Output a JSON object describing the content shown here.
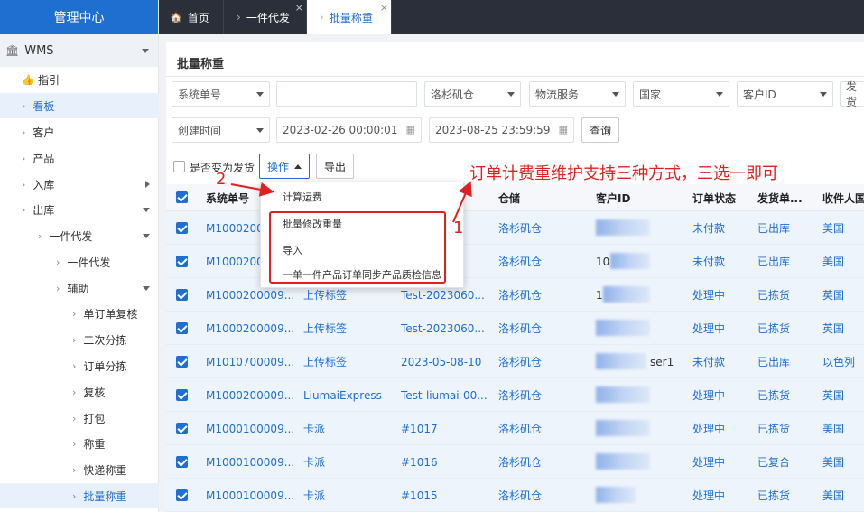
{
  "sidebar": {
    "header": "管理中心",
    "section": "WMS",
    "items": {
      "guide": "指引",
      "board": "看板",
      "customer": "客户",
      "product": "产品",
      "inbound": "入库",
      "outbound": "出库",
      "dropship_group": "一件代发",
      "dropship": "一件代发",
      "aux": "辅助",
      "single_review": "单订单复核",
      "second_sort": "二次分拣",
      "order_sort": "订单分拣",
      "review": "复核",
      "pack": "打包",
      "weigh": "称重",
      "express_weigh": "快递称重",
      "batch_weigh": "批量称重"
    }
  },
  "tabs": {
    "home": "首页",
    "dropship": "一件代发",
    "batch_weigh": "批量称重",
    "close": "×"
  },
  "panel": {
    "title": "批量称重",
    "filters": {
      "field_select": "系统单号",
      "field_input": "",
      "warehouse": "洛杉矶仓",
      "logistics": "物流服务",
      "country": "国家",
      "customer_id": "客户ID",
      "shipping_cut": "发货",
      "time_select": "创建时间",
      "start_time": "2023-02-26 00:00:01",
      "end_time": "2023-08-25 23:59:59",
      "query": "查询"
    },
    "toolbar": {
      "ship_toggle": "是否变为发货",
      "operate": "操作",
      "export": "导出"
    },
    "dropdown": {
      "calc_fee": "计算运费",
      "batch_edit_weight": "批量修改重量",
      "import": "导入",
      "sync_qc": "一单一件产品订单同步产品质检信息"
    },
    "annotation": {
      "text": "订单计费重维护支持三种方式，三选一即可",
      "num1": "1",
      "num2": "2"
    },
    "table": {
      "headers": {
        "sysno": "系统单号",
        "warehouse": "仓储",
        "customer_id": "客户ID",
        "order_status": "订单状态",
        "ship_status": "发货单...",
        "receiver_country": "收件人国家"
      },
      "rows": [
        {
          "sysno": "M1000200009...",
          "logistics": "",
          "ref": "",
          "warehouse": "洛杉矶仓",
          "cust": "",
          "status": "未付款",
          "ship": "已出库",
          "country": "美国"
        },
        {
          "sysno": "M1000200009...",
          "logistics": "",
          "ref": "",
          "warehouse": "洛杉矶仓",
          "cust": "10",
          "status": "未付款",
          "ship": "已出库",
          "country": "美国"
        },
        {
          "sysno": "M1000200009...",
          "logistics": "上传标签",
          "ref": "Test-2023060...",
          "warehouse": "洛杉矶仓",
          "cust": "1",
          "status": "处理中",
          "ship": "已拣货",
          "country": "英国"
        },
        {
          "sysno": "M1000200009...",
          "logistics": "上传标签",
          "ref": "Test-2023060...",
          "warehouse": "洛杉矶仓",
          "cust": "",
          "status": "处理中",
          "ship": "已拣货",
          "country": "英国"
        },
        {
          "sysno": "M1010700009...",
          "logistics": "上传标签",
          "ref": "2023-05-08-10",
          "warehouse": "洛杉矶仓",
          "cust": "ser1",
          "status": "未付款",
          "ship": "已出库",
          "country": "以色列"
        },
        {
          "sysno": "M1000200009...",
          "logistics": "LiumaiExpress",
          "ref": "Test-liumai-00...",
          "warehouse": "洛杉矶仓",
          "cust": "",
          "status": "处理中",
          "ship": "已拣货",
          "country": "英国"
        },
        {
          "sysno": "M1000100009...",
          "logistics": "卡派",
          "ref": "#1017",
          "warehouse": "洛杉矶仓",
          "cust": "",
          "status": "处理中",
          "ship": "已拣货",
          "country": "美国"
        },
        {
          "sysno": "M1000100009...",
          "logistics": "卡派",
          "ref": "#1016",
          "warehouse": "洛杉矶仓",
          "cust": "",
          "status": "处理中",
          "ship": "已复合",
          "country": "美国"
        },
        {
          "sysno": "M1000100009...",
          "logistics": "卡派",
          "ref": "#1015",
          "warehouse": "洛杉矶仓",
          "cust": "",
          "status": "处理中",
          "ship": "已拣货",
          "country": "美国"
        }
      ]
    }
  },
  "colors": {
    "brand_blue": "#1e6fd0",
    "tab_bar": "#2b2f3a",
    "annotation_red": "#e02020"
  }
}
